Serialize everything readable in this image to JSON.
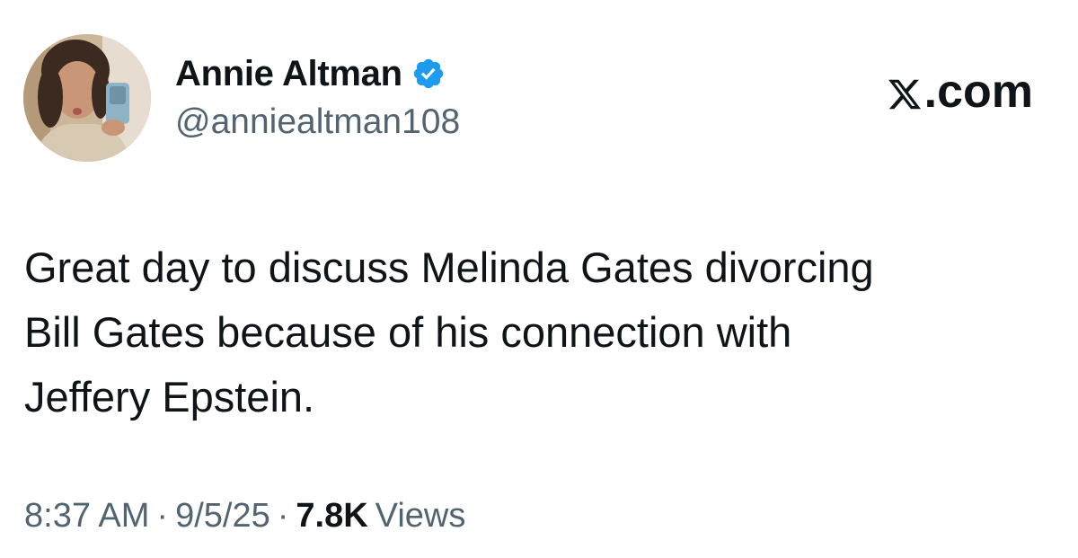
{
  "author": {
    "display_name": "Annie Altman",
    "handle": "@anniealtman108",
    "verified": true,
    "avatar_icon": "profile-photo-avatar"
  },
  "brand": {
    "text": ".com",
    "icon": "x-logo-icon"
  },
  "tweet": {
    "lines": [
      "Great day to discuss Melinda Gates divorcing",
      "Bill Gates because of his connection with",
      "Jeffery Epstein."
    ]
  },
  "meta": {
    "time": "8:37 AM",
    "separator": "·",
    "date": "9/5/25",
    "views_count": "7.8K",
    "views_label": "Views"
  },
  "colors": {
    "verified_blue": "#1d9bf0",
    "text_primary": "#0f1419",
    "text_secondary": "#536471"
  }
}
